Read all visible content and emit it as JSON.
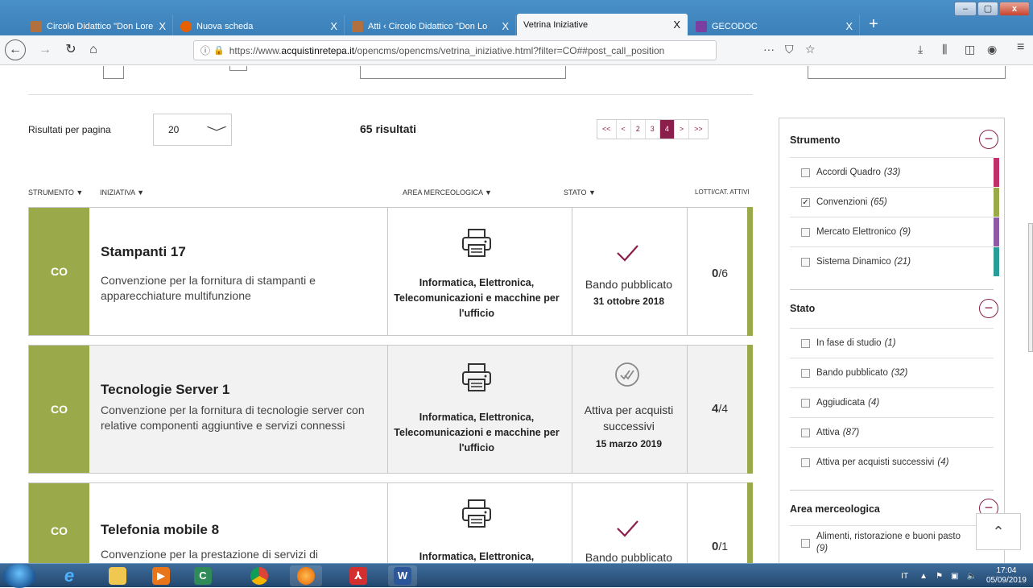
{
  "browser": {
    "tabs": [
      {
        "title": "Circolo Didattico \"Don Lorenzo",
        "close": "X",
        "favicon_color": "#b07040"
      },
      {
        "title": "Nuova scheda",
        "close": "X",
        "favicon_color": "#e66000"
      },
      {
        "title": "Atti ‹ Circolo Didattico \"Don Lo",
        "close": "X",
        "favicon_color": "#b07040"
      },
      {
        "title": "Vetrina Iniziative",
        "close": "X",
        "favicon_color": ""
      },
      {
        "title": "GECODOC",
        "close": "X",
        "favicon_color": "#7a3fa0"
      }
    ],
    "new_tab": "+",
    "window_buttons": {
      "minimize": "–",
      "maximize": "▢",
      "close": "x"
    },
    "url": {
      "prefix": "https://www.",
      "domain": "acquistinretepa.it",
      "path": "/opencms/opencms/vetrina_iniziative.html?filter=CO##post_call_position"
    },
    "nav_icons": [
      "back-icon",
      "forward-icon",
      "reload-icon",
      "home-icon"
    ],
    "toolbar_icons": {
      "more": "···",
      "pocket": "⛉",
      "bookmark": "☆",
      "download": "⤓",
      "library": "⫼",
      "sidebar": "◫",
      "account": "◉",
      "menu": "≡"
    }
  },
  "page": {
    "results_per_page_label": "Risultati per pagina",
    "results_per_page_value": "20",
    "results_count": "65 risultati",
    "pagination": [
      {
        "label": "<<",
        "current": false
      },
      {
        "label": "<",
        "current": false
      },
      {
        "label": "2",
        "current": false
      },
      {
        "label": "3",
        "current": false
      },
      {
        "label": "4",
        "current": true
      },
      {
        "label": ">",
        "current": false
      },
      {
        "label": ">>",
        "current": false
      }
    ],
    "columns": {
      "strumento": "STRUMENTO ▼",
      "iniziativa": "INIZIATIVA ▼",
      "area": "AREA MERCEOLOGICA ▼",
      "stato": "STATO ▼",
      "lotti": "LOTTI/CAT. ATTIVI"
    },
    "items": [
      {
        "badge": "CO",
        "title": "Stampanti 17",
        "description": "Convenzione per la fornitura di stampanti e apparecchiature multifunzione",
        "area": "Informatica, Elettronica, Telecomunicazioni e macchine per l'ufficio",
        "area_icon": "printer-icon",
        "state": "Bando pubblicato",
        "state_icon": "check-icon",
        "date": "31 ottobre 2018",
        "lotti_active": "0",
        "lotti_total": "/6"
      },
      {
        "badge": "CO",
        "title": "Tecnologie Server 1",
        "description": "Convenzione per la fornitura di tecnologie server con relative componenti aggiuntive e servizi connessi",
        "area": "Informatica, Elettronica, Telecomunicazioni e macchine per l'ufficio",
        "area_icon": "printer-icon",
        "state": "Attiva per acquisti successivi",
        "state_icon": "double-check-circle-icon",
        "date": "15 marzo 2019",
        "lotti_active": "4",
        "lotti_total": "/4"
      },
      {
        "badge": "CO",
        "title": "Telefonia mobile 8",
        "description": "Convenzione per la prestazione di servizi di",
        "area": "Informatica, Elettronica,",
        "area_icon": "printer-icon",
        "state": "Bando pubblicato",
        "state_icon": "check-icon",
        "date": "",
        "lotti_active": "0",
        "lotti_total": "/1"
      }
    ],
    "accent_color": "#8a1f4b",
    "co_color": "#9aaa4a"
  },
  "filters": {
    "strumento": {
      "title": "Strumento",
      "options": [
        {
          "label": "Accordi Quadro",
          "count": "(33)",
          "checked": false,
          "color": "#c2306b"
        },
        {
          "label": "Convenzioni",
          "count": "(65)",
          "checked": true,
          "color": "#9aaa4a"
        },
        {
          "label": "Mercato Elettronico",
          "count": "(9)",
          "checked": false,
          "color": "#8c5aa6"
        },
        {
          "label": "Sistema Dinamico",
          "count": "(21)",
          "checked": false,
          "color": "#2a9d9a"
        }
      ]
    },
    "stato": {
      "title": "Stato",
      "options": [
        {
          "label": "In fase di studio",
          "count": "(1)",
          "checked": false
        },
        {
          "label": "Bando pubblicato",
          "count": "(32)",
          "checked": false
        },
        {
          "label": "Aggiudicata",
          "count": "(4)",
          "checked": false
        },
        {
          "label": "Attiva",
          "count": "(87)",
          "checked": false
        },
        {
          "label": "Attiva per acquisti successivi",
          "count": "(4)",
          "checked": false
        }
      ]
    },
    "area": {
      "title": "Area merceologica",
      "options": [
        {
          "label": "Alimenti, ristorazione e buoni pasto",
          "count": "(9)",
          "checked": false
        }
      ]
    },
    "toggle": "−",
    "scroll_top": "⌃"
  },
  "taskbar": {
    "apps": [
      "ie-icon",
      "explorer-icon",
      "media-player-icon",
      "camtasia-icon",
      "chrome-icon",
      "firefox-icon",
      "acrobat-icon",
      "word-icon"
    ],
    "language": "IT",
    "time": "17:04",
    "date": "05/09/2019"
  }
}
